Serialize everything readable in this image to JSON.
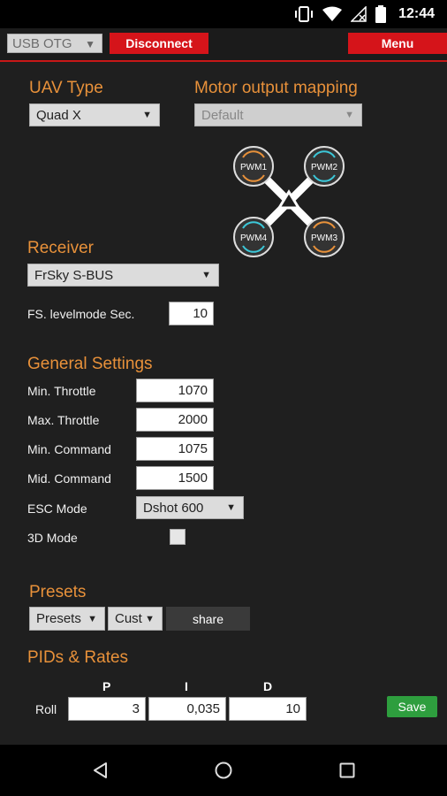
{
  "status_bar": {
    "time": "12:44",
    "icons": [
      "vibrate-icon",
      "wifi-icon",
      "no-signal-icon",
      "battery-icon"
    ]
  },
  "toolbar": {
    "connection_select": "USB OTG",
    "disconnect_label": "Disconnect",
    "menu_label": "Menu"
  },
  "uav_type": {
    "title": "UAV Type",
    "value": "Quad X"
  },
  "motor_mapping": {
    "title": "Motor output mapping",
    "value": "Default",
    "motors": [
      "PWM1",
      "PWM2",
      "PWM4",
      "PWM3"
    ]
  },
  "receiver": {
    "title": "Receiver",
    "value": "FrSky S-BUS",
    "fs_label": "FS. levelmode Sec.",
    "fs_value": "10"
  },
  "general": {
    "title": "General Settings",
    "min_throttle_label": "Min. Throttle",
    "min_throttle": "1070",
    "max_throttle_label": "Max. Throttle",
    "max_throttle": "2000",
    "min_command_label": "Min. Command",
    "min_command": "1075",
    "mid_command_label": "Mid. Command",
    "mid_command": "1500",
    "esc_mode_label": "ESC Mode",
    "esc_mode": "Dshot 600",
    "mode_3d_label": "3D Mode"
  },
  "presets": {
    "title": "Presets",
    "select_label": "Presets",
    "cust_label": "Cust",
    "share_label": "share"
  },
  "pids": {
    "title": "PIDs & Rates",
    "col_p": "P",
    "col_i": "I",
    "col_d": "D",
    "row_label": "Roll",
    "p": "3",
    "i": "0,035",
    "d": "10",
    "save_label": "Save"
  },
  "colors": {
    "accent": "#e8913a",
    "toolbar_red": "#d5141a",
    "save_green": "#2e9e3e",
    "background": "#1f1f1f"
  }
}
